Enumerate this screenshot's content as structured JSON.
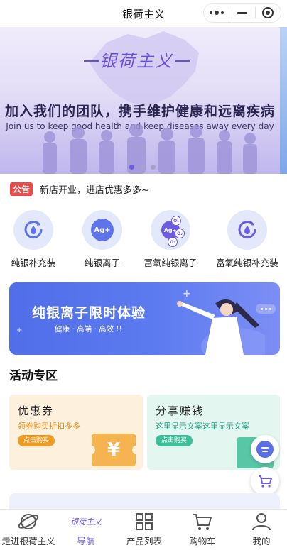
{
  "topbar": {
    "title": "银荷主义"
  },
  "banner": {
    "logo": "银荷主义",
    "headline": "加入我们的团队，携手维护健康和远离疾病",
    "subline": "Join us to keep good health and keep diseases away every day",
    "pages": 3,
    "current_page": 1
  },
  "notice": {
    "tag": "公告",
    "text": "新店开业，进店优惠多多~"
  },
  "categories": [
    {
      "label": "纯银补充装",
      "icon": "silver-refill-icon"
    },
    {
      "label": "纯银离子",
      "icon": "silver-ion-icon",
      "badge": "Ag+"
    },
    {
      "label": "富氧纯银离子",
      "icon": "oxygen-silver-ion-icon",
      "badge": "Ag+",
      "o2": "O₂"
    },
    {
      "label": "富氧纯银补充装",
      "icon": "oxygen-silver-refill-icon"
    }
  ],
  "promo": {
    "title": "纯银离子限时体验",
    "subtitle": "健康 · 高端 · 高效 !!"
  },
  "section": {
    "title": "活动专区"
  },
  "cards": {
    "coupon": {
      "title": "优惠券",
      "subtitle": "领券购买折扣多多",
      "button": "点击购买",
      "symbol": "¥"
    },
    "share": {
      "title": "分享赚钱",
      "subtitle": "这里显示文案这里显示文案",
      "button": "点击购买"
    }
  },
  "tabbar": [
    {
      "label": "走进银荷主义",
      "icon": "planet-icon"
    },
    {
      "label": "导航",
      "icon": "brand-logo-icon",
      "logo_text": "银荷主义",
      "active": true
    },
    {
      "label": "产品列表",
      "icon": "grid-icon"
    },
    {
      "label": "购物车",
      "icon": "cart-icon"
    },
    {
      "label": "我的",
      "icon": "user-icon"
    }
  ],
  "colors": {
    "accent": "#6b5ce0",
    "promo": "#4f6ee8",
    "notice_tag": "#ef4a4a",
    "coupon": "#ee9b24",
    "share": "#3dbd98"
  }
}
